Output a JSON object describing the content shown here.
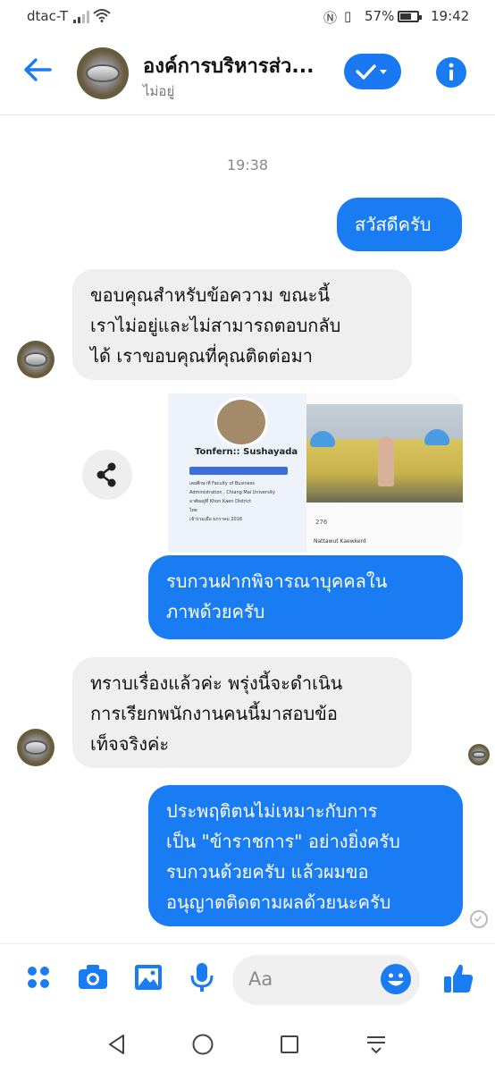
{
  "status_bar": {
    "carrier": "dtac-T",
    "battery": "57%",
    "time": "19:42"
  },
  "header": {
    "title": "องค์การบริหารส่ว...",
    "subtitle": "ไม่อยู่"
  },
  "chat": {
    "timestamp": "19:38",
    "messages": [
      {
        "from": "me",
        "text": "สวัสดีครับ"
      },
      {
        "from": "page",
        "lines": [
          "ขอบคุณสำหรับข้อความ ขณะนี้",
          "เราไม่อยู่และไม่สามารถตอบกลับ",
          "ได้ เราขอบคุณที่คุณติดต่อมา"
        ]
      },
      {
        "from": "me",
        "lines": [
          "รบกวนฝากพิจารณาบุคคลใน",
          "ภาพด้วยครับ"
        ]
      },
      {
        "from": "page",
        "lines": [
          "ทราบเรื่องแล้วค่ะ พรุ่งนี้จะดำเนิน",
          "การเรียกพนักงานคนนี้มาสอบข้อ",
          "เท็จจริงค่ะ"
        ]
      },
      {
        "from": "me",
        "lines": [
          "ประพฤติตนไม่เหมาะกับการ",
          "เป็น \"ข้าราชการ\" อย่างยิ่งครับ",
          "รบกวนด้วยครับ แล้วผมขอ",
          "อนุญาตติดตามผลด้วยนะครับ"
        ]
      }
    ],
    "shared_image": {
      "profile_name": "Tonfern:: Sushayada",
      "profile_lines": [
        "เคยศึกษาที่ Faculty of Business",
        "Administration , Chiang Mai University",
        "อาศัยอยู่ที่ Khon Kaen District",
        "ไทย",
        "เข้าร่วมเมื่อ มกราคม 2016"
      ],
      "reaction_count": "276",
      "commenter": "Nattawut Kaewkerd"
    }
  },
  "composer": {
    "placeholder": "Aa"
  },
  "colors": {
    "accent": "#1a7cf3",
    "incoming_bubble": "#efefef"
  }
}
